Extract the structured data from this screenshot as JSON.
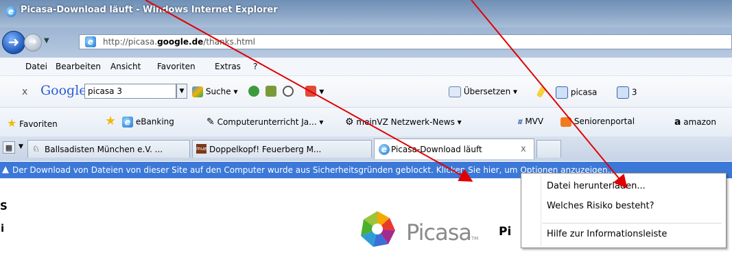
{
  "window": {
    "title": "Picasa-Download läuft - Windows Internet Explorer"
  },
  "nav": {
    "url_prefix": "http://picasa.",
    "url_host": "google.de",
    "url_suffix": "/thanks.html"
  },
  "menu": [
    "Datei",
    "Bearbeiten",
    "Ansicht",
    "Favoriten",
    "Extras",
    "?"
  ],
  "google": {
    "close": "x",
    "brand": "Google",
    "search_value": "picasa 3",
    "search_label": "Suche",
    "translate_label": "Übersetzen",
    "term1": "picasa",
    "term2": "3"
  },
  "favorites": {
    "label": "Favoriten",
    "items": [
      "eBanking",
      "Computerunterricht Ja...",
      "meinVZ Netzwerk-News",
      "MVV",
      "Seniorenportal",
      "amazon"
    ]
  },
  "tabs": {
    "items": [
      "Ballsadisten München e.V. ...",
      "Doppelkopf! Feuerberg M...",
      "Picasa-Download läuft"
    ],
    "close": "x"
  },
  "infobar": {
    "message": "Der Download von Dateien von dieser Site auf den Computer wurde aus Sicherheitsgründen geblockt. Klicken Sie hier, um Optionen anzuzeigen..."
  },
  "context_menu": {
    "items": [
      "Datei herunterladen...",
      "Welches Risiko besteht?",
      "Hilfe zur Informationsleiste"
    ]
  },
  "page": {
    "logo_text": "Picasa",
    "logo_tm": "TM",
    "heading": "Pi"
  },
  "left_fragments": [
    "S",
    "i"
  ],
  "colors": {
    "infobar": "#3b78d8",
    "annotation_arrow": "#e00000",
    "titlebar": "#7f9cc0"
  }
}
